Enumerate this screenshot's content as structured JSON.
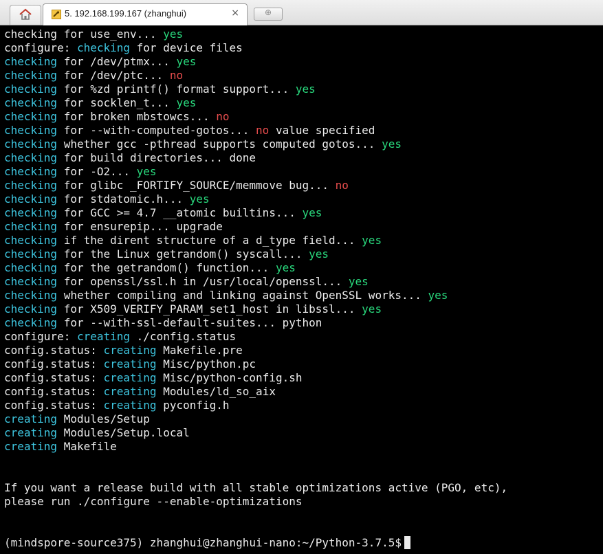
{
  "tabs": {
    "home_icon": "home-icon",
    "session_icon": "terminal-key-icon",
    "active_title": "5. 192.168.199.167 (zhanghui)",
    "close_glyph": "×",
    "new_tab_glyph": "⊕"
  },
  "colors": {
    "background": "#000000",
    "text": "#ececec",
    "keyword_cyan": "#3ec6e0",
    "yes_green": "#29d97d",
    "no_red": "#e84d4d"
  },
  "terminal": {
    "cursor": true,
    "lines": [
      [
        [
          "checking for use_env... ",
          "d"
        ],
        [
          "yes",
          "g"
        ]
      ],
      [
        [
          "configure: ",
          "d"
        ],
        [
          "checking",
          "c"
        ],
        [
          " for device files",
          "d"
        ]
      ],
      [
        [
          "checking",
          "c"
        ],
        [
          " for /dev/ptmx... ",
          "d"
        ],
        [
          "yes",
          "g"
        ]
      ],
      [
        [
          "checking",
          "c"
        ],
        [
          " for /dev/ptc... ",
          "d"
        ],
        [
          "no",
          "r"
        ]
      ],
      [
        [
          "checking",
          "c"
        ],
        [
          " for %zd printf() format support... ",
          "d"
        ],
        [
          "yes",
          "g"
        ]
      ],
      [
        [
          "checking",
          "c"
        ],
        [
          " for socklen_t... ",
          "d"
        ],
        [
          "yes",
          "g"
        ]
      ],
      [
        [
          "checking",
          "c"
        ],
        [
          " for broken mbstowcs... ",
          "d"
        ],
        [
          "no",
          "r"
        ]
      ],
      [
        [
          "checking",
          "c"
        ],
        [
          " for --with-computed-gotos... ",
          "d"
        ],
        [
          "no",
          "r"
        ],
        [
          " value specified",
          "d"
        ]
      ],
      [
        [
          "checking",
          "c"
        ],
        [
          " whether gcc -pthread supports computed gotos... ",
          "d"
        ],
        [
          "yes",
          "g"
        ]
      ],
      [
        [
          "checking",
          "c"
        ],
        [
          " for build directories... done",
          "d"
        ]
      ],
      [
        [
          "checking",
          "c"
        ],
        [
          " for -O2... ",
          "d"
        ],
        [
          "yes",
          "g"
        ]
      ],
      [
        [
          "checking",
          "c"
        ],
        [
          " for glibc _FORTIFY_SOURCE/memmove bug... ",
          "d"
        ],
        [
          "no",
          "r"
        ]
      ],
      [
        [
          "checking",
          "c"
        ],
        [
          " for stdatomic.h... ",
          "d"
        ],
        [
          "yes",
          "g"
        ]
      ],
      [
        [
          "checking",
          "c"
        ],
        [
          " for GCC >= 4.7 __atomic builtins... ",
          "d"
        ],
        [
          "yes",
          "g"
        ]
      ],
      [
        [
          "checking",
          "c"
        ],
        [
          " for ensurepip... upgrade",
          "d"
        ]
      ],
      [
        [
          "checking",
          "c"
        ],
        [
          " if the dirent structure of a d_type field... ",
          "d"
        ],
        [
          "yes",
          "g"
        ]
      ],
      [
        [
          "checking",
          "c"
        ],
        [
          " for the Linux getrandom() syscall... ",
          "d"
        ],
        [
          "yes",
          "g"
        ]
      ],
      [
        [
          "checking",
          "c"
        ],
        [
          " for the getrandom() function... ",
          "d"
        ],
        [
          "yes",
          "g"
        ]
      ],
      [
        [
          "checking",
          "c"
        ],
        [
          " for openssl/ssl.h in /usr/local/openssl... ",
          "d"
        ],
        [
          "yes",
          "g"
        ]
      ],
      [
        [
          "checking",
          "c"
        ],
        [
          " whether compiling and linking against OpenSSL works... ",
          "d"
        ],
        [
          "yes",
          "g"
        ]
      ],
      [
        [
          "checking",
          "c"
        ],
        [
          " for X509_VERIFY_PARAM_set1_host in libssl... ",
          "d"
        ],
        [
          "yes",
          "g"
        ]
      ],
      [
        [
          "checking",
          "c"
        ],
        [
          " for --with-ssl-default-suites... python",
          "d"
        ]
      ],
      [
        [
          "configure: ",
          "d"
        ],
        [
          "creating",
          "c"
        ],
        [
          " ./config.status",
          "d"
        ]
      ],
      [
        [
          "config.status: ",
          "d"
        ],
        [
          "creating",
          "c"
        ],
        [
          " Makefile.pre",
          "d"
        ]
      ],
      [
        [
          "config.status: ",
          "d"
        ],
        [
          "creating",
          "c"
        ],
        [
          " Misc/python.pc",
          "d"
        ]
      ],
      [
        [
          "config.status: ",
          "d"
        ],
        [
          "creating",
          "c"
        ],
        [
          " Misc/python-config.sh",
          "d"
        ]
      ],
      [
        [
          "config.status: ",
          "d"
        ],
        [
          "creating",
          "c"
        ],
        [
          " Modules/ld_so_aix",
          "d"
        ]
      ],
      [
        [
          "config.status: ",
          "d"
        ],
        [
          "creating",
          "c"
        ],
        [
          " pyconfig.h",
          "d"
        ]
      ],
      [
        [
          "creating",
          "c"
        ],
        [
          " Modules/Setup",
          "d"
        ]
      ],
      [
        [
          "creating",
          "c"
        ],
        [
          " Modules/Setup.local",
          "d"
        ]
      ],
      [
        [
          "creating",
          "c"
        ],
        [
          " Makefile",
          "d"
        ]
      ],
      [],
      [],
      [
        [
          "If you want a release build with all stable optimizations active (PGO, etc),",
          "d"
        ]
      ],
      [
        [
          "please run ./configure --enable-optimizations",
          "d"
        ]
      ],
      [],
      [],
      [
        [
          "(mindspore-source375) zhanghui@zhanghui-nano:~/Python-3.7.5$",
          "d"
        ]
      ]
    ]
  }
}
